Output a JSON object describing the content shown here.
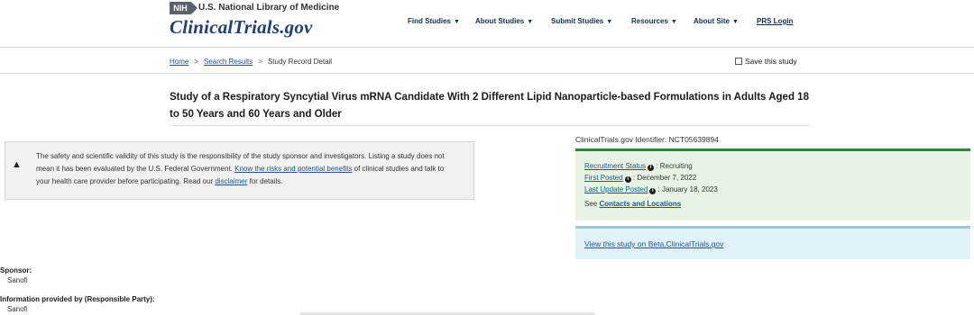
{
  "header": {
    "nih_badge": "NIH",
    "nlm_text": "U.S. National Library of Medicine",
    "logo": "ClinicalTrials.gov",
    "nav": [
      {
        "label": "Find Studies"
      },
      {
        "label": "About Studies"
      },
      {
        "label": "Submit Studies"
      },
      {
        "label": "Resources"
      },
      {
        "label": "About Site"
      }
    ],
    "prs_login": "PRS Login"
  },
  "breadcrumb": {
    "home": "Home",
    "search_results": "Search Results",
    "current": "Study Record Detail",
    "separator": ">"
  },
  "save_study": "Save this study",
  "study_title": "Study of a Respiratory Syncytial Virus mRNA Candidate With 2 Different Lipid Nanoparticle-based Formulations in Adults Aged 18 to 50 Years and 60 Years and Older",
  "disclaimer": {
    "text1": "The safety and scientific validity of this study is the responsibility of the study sponsor and investigators. Listing a study does not mean it has been evaluated by the U.S. Federal Government. ",
    "risk_link": "Know the risks and potential benefits",
    "text2": " of clinical studies and talk to your health care provider before participating. Read our ",
    "disclaimer_link": "disclaimer",
    "text3": " for details."
  },
  "status": {
    "identifier": "ClinicalTrials.gov Identifier: NCT05639894",
    "recruitment_label": "Recruitment Status",
    "recruitment_value": ": Recruiting",
    "first_posted_label": "First Posted",
    "first_posted_value": ": December 7, 2022",
    "last_update_label": "Last Update Posted",
    "last_update_value": ": January 18, 2023",
    "see_text": "See ",
    "contacts_link": "Contacts and Locations",
    "beta_link": "View this study on Beta.ClinicalTrials.gov"
  },
  "sponsor": {
    "label": "Sponsor:",
    "value": "Sanofi",
    "info_label": "Information provided by (Responsible Party):",
    "info_value": "Sanofi"
  },
  "colors": {
    "logo_blue": "#1f3f7a",
    "link_blue": "#205493",
    "status_green_bg": "#e7f4e4",
    "status_green_border": "#2e8540",
    "beta_bg": "#e1f3f8"
  }
}
